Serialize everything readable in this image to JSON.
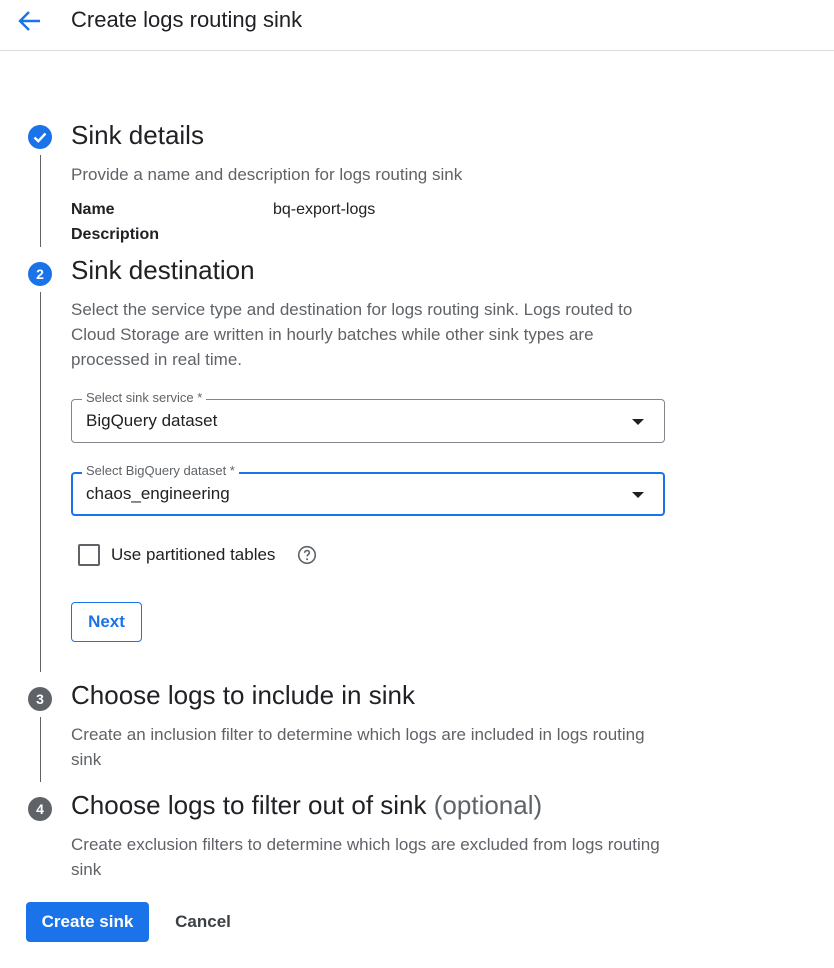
{
  "header": {
    "title": "Create logs routing sink",
    "back_icon": "arrow-back-icon"
  },
  "colors": {
    "accent": "#1a73e8",
    "step_inactive": "#5f6368",
    "text": "#202124",
    "muted": "#5f6368"
  },
  "steps": [
    {
      "icon": "check-circle-icon",
      "title": "Sink details",
      "description": "Provide a name and description for logs routing sink",
      "fields": [
        {
          "key": "Name",
          "value": "bq-export-logs"
        },
        {
          "key": "Description",
          "value": ""
        }
      ]
    },
    {
      "number": "2",
      "title": "Sink destination",
      "description": "Select the service type and destination for logs routing sink. Logs routed to Cloud Storage are written in hourly batches while other sink types are processed in real time.",
      "sink_service": {
        "label": "Select sink service *",
        "value": "BigQuery dataset"
      },
      "bigquery_dataset": {
        "label": "Select BigQuery dataset *",
        "value": "chaos_engineering"
      },
      "partitioned": {
        "label": "Use partitioned tables",
        "checked": false,
        "help_icon": "help-circle-icon"
      },
      "next_label": "Next"
    },
    {
      "number": "3",
      "title": "Choose logs to include in sink",
      "description": "Create an inclusion filter to determine which logs are included in logs routing sink"
    },
    {
      "number": "4",
      "title": "Choose logs to filter out of sink",
      "optional": "(optional)",
      "description": "Create exclusion filters to determine which logs are excluded from logs routing sink"
    }
  ],
  "footer": {
    "create_label": "Create sink",
    "cancel_label": "Cancel"
  }
}
